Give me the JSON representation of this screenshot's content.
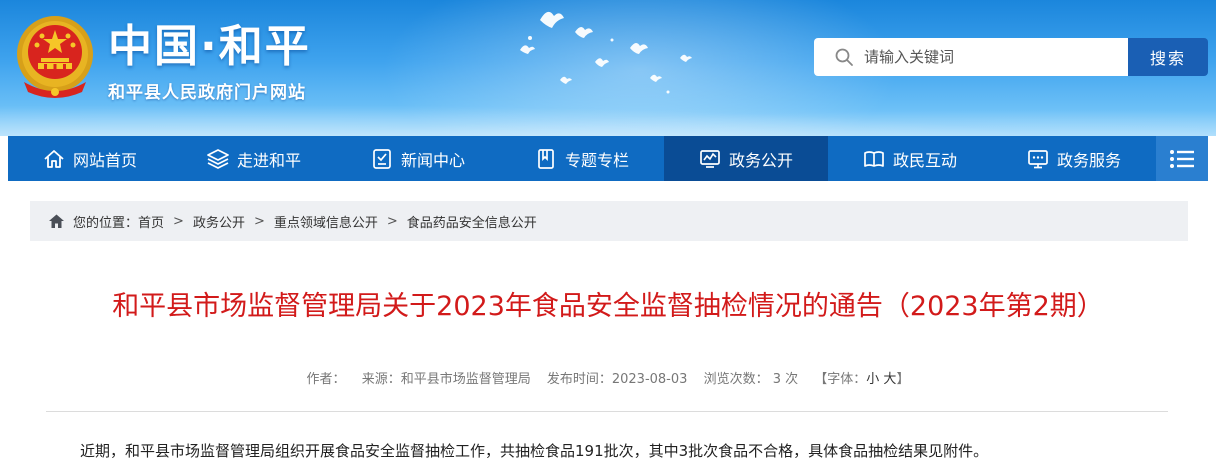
{
  "header": {
    "site_title": "中国·和平",
    "site_subtitle": "和平县人民政府门户网站"
  },
  "search": {
    "placeholder": "请输入关键词",
    "button_label": "搜索"
  },
  "nav": {
    "items": [
      {
        "label": "网站首页",
        "icon": "home-icon"
      },
      {
        "label": "走进和平",
        "icon": "layers-icon"
      },
      {
        "label": "新闻中心",
        "icon": "newspaper-icon"
      },
      {
        "label": "专题专栏",
        "icon": "bookmark-icon"
      },
      {
        "label": "政务公开",
        "icon": "chart-monitor-icon",
        "active": true
      },
      {
        "label": "政民互动",
        "icon": "book-open-icon"
      },
      {
        "label": "政务服务",
        "icon": "monitor-chat-icon"
      }
    ],
    "menu_icon": "hamburger-menu-icon"
  },
  "breadcrumb": {
    "prefix": "您的位置：",
    "items": [
      "首页",
      "政务公开",
      "重点领域信息公开",
      "食品药品安全信息公开"
    ],
    "separator": ">"
  },
  "article": {
    "title": "和平县市场监督管理局关于2023年食品安全监督抽检情况的通告（2023年第2期）",
    "meta": {
      "author_label": "作者：",
      "source": "来源：和平县市场监督管理局",
      "publish_time": "发布时间：2023-08-03",
      "views": "浏览次数： 3 次",
      "font_size_prefix": "【字体：",
      "font_small": "小",
      "font_large": "大",
      "font_size_suffix": "】"
    },
    "body": "近期，和平县市场监督管理局组织开展食品安全监督抽检工作，共抽检食品191批次，其中3批次食品不合格，具体食品抽检结果见附件。"
  },
  "colors": {
    "nav_bg": "#0f6bc2",
    "nav_active": "#0a4c95",
    "title_red": "#d21a1a",
    "search_button": "#1a5fb4"
  }
}
